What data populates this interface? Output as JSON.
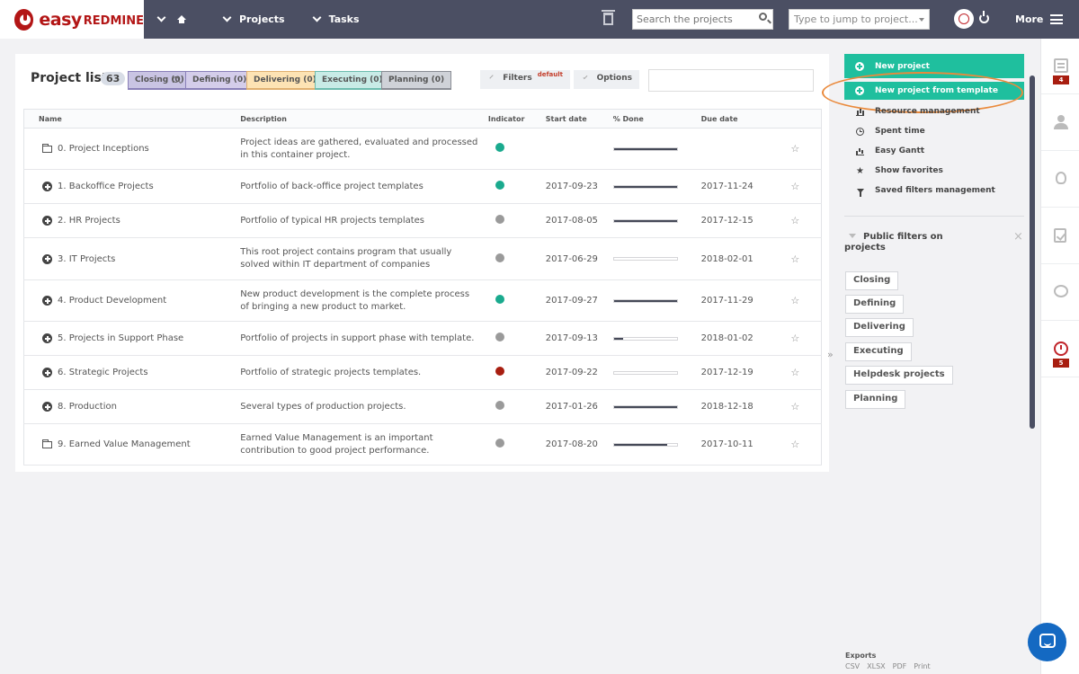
{
  "header": {
    "logo_easy": "easy",
    "logo_redmine": "REDMINE",
    "nav_projects": "Projects",
    "nav_tasks": "Tasks",
    "search_placeholder": "Search the projects",
    "jump_placeholder": "Type to jump to project...",
    "more": "More"
  },
  "list": {
    "title": "Project list",
    "count": "63",
    "tags": [
      "Closing (0)",
      "Defining (0)",
      "Delivering (0)",
      "Executing (0)",
      "Planning (0)"
    ],
    "filters_label": "Filters",
    "filters_badge": "default",
    "options_label": "Options",
    "columns": [
      "Name",
      "Description",
      "Indicator",
      "Start date",
      "% Done",
      "Due date"
    ],
    "rows": [
      {
        "name": "0. Project Inceptions",
        "icon": "folder-icon",
        "desc": "Project ideas are gathered, evaluated and processed in this container project.",
        "indicator": "green",
        "start": "",
        "done": 1.0,
        "due": ""
      },
      {
        "name": "1. Backoffice Projects",
        "icon": "plus-icon",
        "desc": "Portfolio of back-office project templates",
        "indicator": "green",
        "start": "2017-09-23",
        "done": 1.0,
        "due": "2017-11-24"
      },
      {
        "name": "2. HR Projects",
        "icon": "plus-icon",
        "desc": "Portfolio of typical HR projects templates",
        "indicator": "gray",
        "start": "2017-08-05",
        "done": 1.0,
        "due": "2017-12-15"
      },
      {
        "name": "3. IT Projects",
        "icon": "plus-icon",
        "desc": "This root project contains program that usually solved within IT department of companies",
        "indicator": "gray",
        "start": "2017-06-29",
        "done": 0.0,
        "due": "2018-02-01"
      },
      {
        "name": "4. Product Development",
        "icon": "plus-icon",
        "desc": "New product development is the complete process of bringing a new product to market.",
        "indicator": "green",
        "start": "2017-09-27",
        "done": 1.0,
        "due": "2017-11-29"
      },
      {
        "name": "5. Projects in Support Phase",
        "icon": "plus-icon",
        "desc": "Portfolio of projects in support phase with template.",
        "indicator": "gray",
        "start": "2017-09-13",
        "done": 0.15,
        "due": "2018-01-02"
      },
      {
        "name": "6. Strategic Projects",
        "icon": "plus-icon",
        "desc": "Portfolio of strategic projects templates.",
        "indicator": "red",
        "start": "2017-09-22",
        "done": 0.0,
        "due": "2017-12-19"
      },
      {
        "name": "8. Production",
        "icon": "plus-icon",
        "desc": "Several types of production projects.",
        "indicator": "gray",
        "start": "2017-01-26",
        "done": 1.0,
        "due": "2018-12-18"
      },
      {
        "name": "9. Earned Value Management",
        "icon": "folder-icon",
        "desc": "Earned Value Management is an important contribution to good project performance.",
        "indicator": "gray",
        "start": "2017-08-20",
        "done": 0.85,
        "due": "2017-10-11"
      }
    ]
  },
  "sidebar": {
    "new_project": "New project",
    "new_from_template": "New project from template",
    "menu": [
      {
        "label": "Resource management",
        "icon": "bars-icon"
      },
      {
        "label": "Spent time",
        "icon": "clock-icon"
      },
      {
        "label": "Easy Gantt",
        "icon": "gantt-icon"
      },
      {
        "label": "Show favorites",
        "icon": "star-icon"
      },
      {
        "label": "Saved filters management",
        "icon": "funnel-icon"
      }
    ],
    "public_filters_title": "Public filters on projects",
    "public_filters": [
      "Closing",
      "Defining",
      "Delivering",
      "Executing",
      "Helpdesk projects",
      "Planning"
    ],
    "exports_label": "Exports",
    "exports": [
      "CSV",
      "XLSX",
      "PDF",
      "Print"
    ]
  },
  "rail": {
    "news_badge": "4",
    "timer_badge": "5"
  },
  "colors": {
    "topbar": "#4b4f63",
    "accent": "#1fbf9e",
    "brand": "#b31616",
    "highlight": "#ea8a3c"
  }
}
